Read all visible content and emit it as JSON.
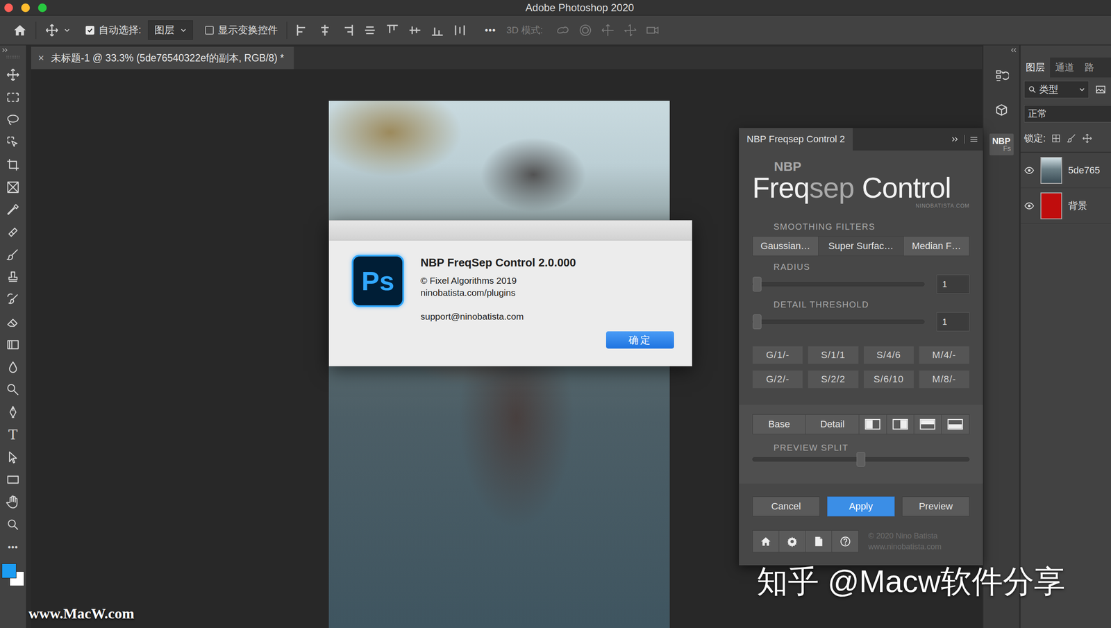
{
  "window": {
    "title": "Adobe Photoshop 2020"
  },
  "options_bar": {
    "auto_select": {
      "label": "自动选择:",
      "checked": true
    },
    "target": "图层",
    "show_transform": {
      "label": "显示变换控件",
      "checked": false
    },
    "more": "•••",
    "mode_3d": {
      "label": "3D 模式:",
      "disabled": true
    }
  },
  "document": {
    "tab": "未标题-1 @ 33.3% (5de76540322ef的副本, RGB/8) *",
    "close": "×"
  },
  "toolbar": {
    "type_tool": "T",
    "more": "•••",
    "swatches": [
      {
        "name": "foreground",
        "color": "#1c9cf2"
      },
      {
        "name": "background",
        "color": "#ffffff"
      }
    ]
  },
  "side_strip": {
    "plugin_icon": {
      "top": "NBP",
      "bottom": "Fs"
    }
  },
  "layers_panel": {
    "tabs": [
      {
        "label": "图层",
        "selected": true
      },
      {
        "label": "通道",
        "selected": false
      },
      {
        "label": "路",
        "selected": false
      }
    ],
    "filter": "类型",
    "blend_mode": "正常",
    "lock_label": "锁定:",
    "layers": [
      {
        "name": "5de765",
        "visible": true,
        "kind": "photo",
        "color": "#6b7f86"
      },
      {
        "name": "背景",
        "visible": true,
        "kind": "fill",
        "color": "#c00d0d"
      }
    ]
  },
  "plugin_panel": {
    "tab": "NBP Freqsep Control 2",
    "logo": {
      "brand": "NBP",
      "freq": "Freq",
      "sep": "sep",
      "control": "Control",
      "site": "NINOBATISTA.COM"
    },
    "filters_label": "SMOOTHING FILTERS",
    "filters": [
      {
        "label": "Gaussian…",
        "selected": false
      },
      {
        "label": "Super Surfac…",
        "selected": true
      },
      {
        "label": "Median F…",
        "selected": false
      }
    ],
    "sliders": [
      {
        "label": "RADIUS",
        "level": 0,
        "value": "1"
      },
      {
        "label": "DETAIL THRESHOLD",
        "level": 0,
        "value": "1"
      }
    ],
    "presets": [
      "G/1/-",
      "S/1/1",
      "S/4/6",
      "M/4/-",
      "G/2/-",
      "S/2/2",
      "S/6/10",
      "M/8/-"
    ],
    "views": [
      "Base",
      "Detail"
    ],
    "split_label": "PREVIEW SPLIT",
    "split_level": 0.5,
    "actions": [
      {
        "label": "Cancel",
        "primary": false
      },
      {
        "label": "Apply",
        "primary": true
      },
      {
        "label": "Preview",
        "primary": false
      }
    ],
    "credits": [
      "© 2020 Nino Batista",
      "www.ninobatista.com"
    ]
  },
  "dialog": {
    "icon": "Ps",
    "title": "NBP FreqSep Control 2.0.000",
    "lines": [
      "© Fixel Algorithms 2019",
      "ninobatista.com/plugins"
    ],
    "support": "support@ninobatista.com",
    "button": "确定"
  },
  "watermarks": {
    "zhihu": "知乎 @Macw软件分享",
    "site": "www.MacW.com"
  }
}
